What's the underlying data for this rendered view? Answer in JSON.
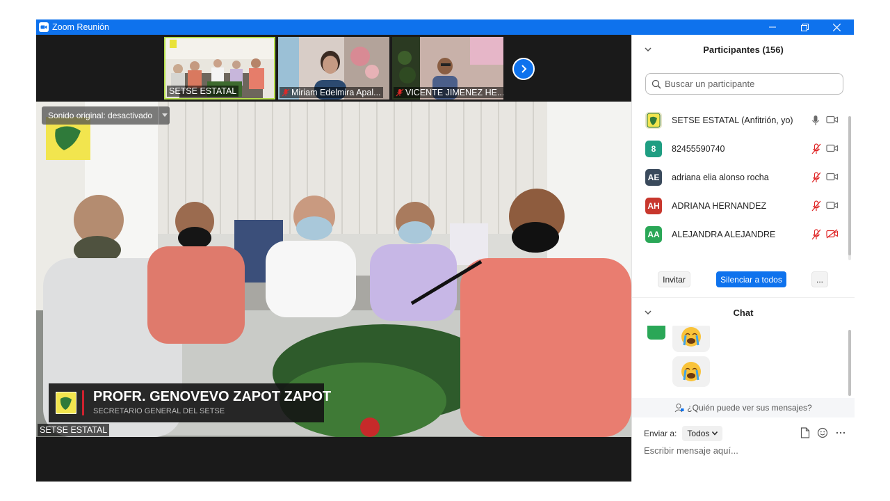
{
  "window": {
    "title": "Zoom Reunión"
  },
  "thumbnails": [
    {
      "name": "SETSE ESTATAL",
      "muted": false
    },
    {
      "name": "Miriam Edelmira Apal...",
      "muted": true
    },
    {
      "name": "VICENTE JIMENEZ HE...",
      "muted": true
    }
  ],
  "main_video": {
    "sound_button": "Sonido original: desactivado",
    "lower_third_name": "PROFR. GENOVEVO ZAPOT ZAPOT",
    "lower_third_subtitle": "SECRETARIO GENERAL DEL SETSE",
    "participant_name": "SETSE ESTATAL"
  },
  "participants": {
    "title": "Participantes (156)",
    "search_placeholder": "Buscar un participante",
    "list": [
      {
        "initials": "",
        "name": "SETSE ESTATAL (Anfitrión, yo)",
        "color": "#e6e6c8",
        "mic": "on",
        "video": "on"
      },
      {
        "initials": "8",
        "name": "82455590740",
        "color": "#1f9e82",
        "mic": "muted",
        "video": "on"
      },
      {
        "initials": "AE",
        "name": "adriana elia alonso rocha",
        "color": "#3a4a5c",
        "mic": "muted",
        "video": "on"
      },
      {
        "initials": "AH",
        "name": "ADRIANA HERNANDEZ",
        "color": "#c8372d",
        "mic": "muted",
        "video": "on"
      },
      {
        "initials": "AA",
        "name": "ALEJANDRA ALEJANDRE",
        "color": "#2aa757",
        "mic": "muted",
        "video": "off"
      }
    ],
    "invite_label": "Invitar",
    "mute_all_label": "Silenciar a todos",
    "more_label": "..."
  },
  "chat": {
    "title": "Chat",
    "who_can_see": "¿Quién puede ver sus mensajes?",
    "send_to_label": "Enviar a:",
    "send_to_value": "Todos",
    "message_placeholder": "Escribir mensaje aquí..."
  },
  "colors": {
    "accent": "#0e72ed",
    "muted_red": "#e02828"
  }
}
